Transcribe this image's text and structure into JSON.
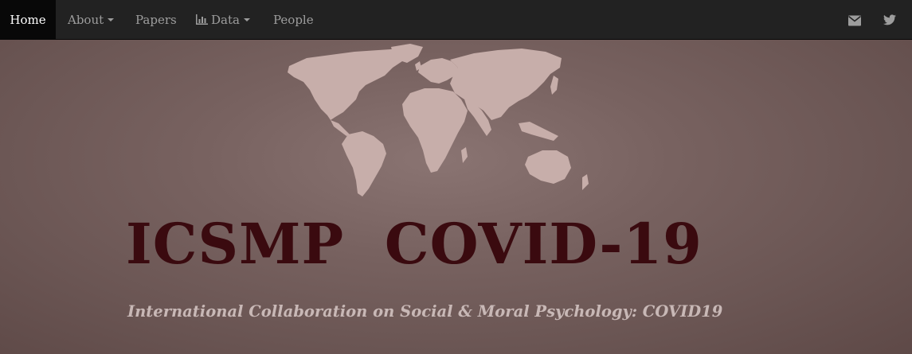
{
  "nav": {
    "home": "Home",
    "about": "About",
    "papers": "Papers",
    "data": "Data",
    "people": "People"
  },
  "icons": {
    "data": "bar-chart-icon",
    "email": "envelope-icon",
    "social": "twitter-icon"
  },
  "hero": {
    "title": "ICSMP  COVID-19",
    "subtitle": "International Collaboration on Social & Moral Psychology: COVID19"
  },
  "colors": {
    "navbar": "#222222",
    "active_tab": "#080808",
    "title": "#3a0a0f",
    "subtitle": "#c8b8b6",
    "map": "#c7aeaa"
  }
}
